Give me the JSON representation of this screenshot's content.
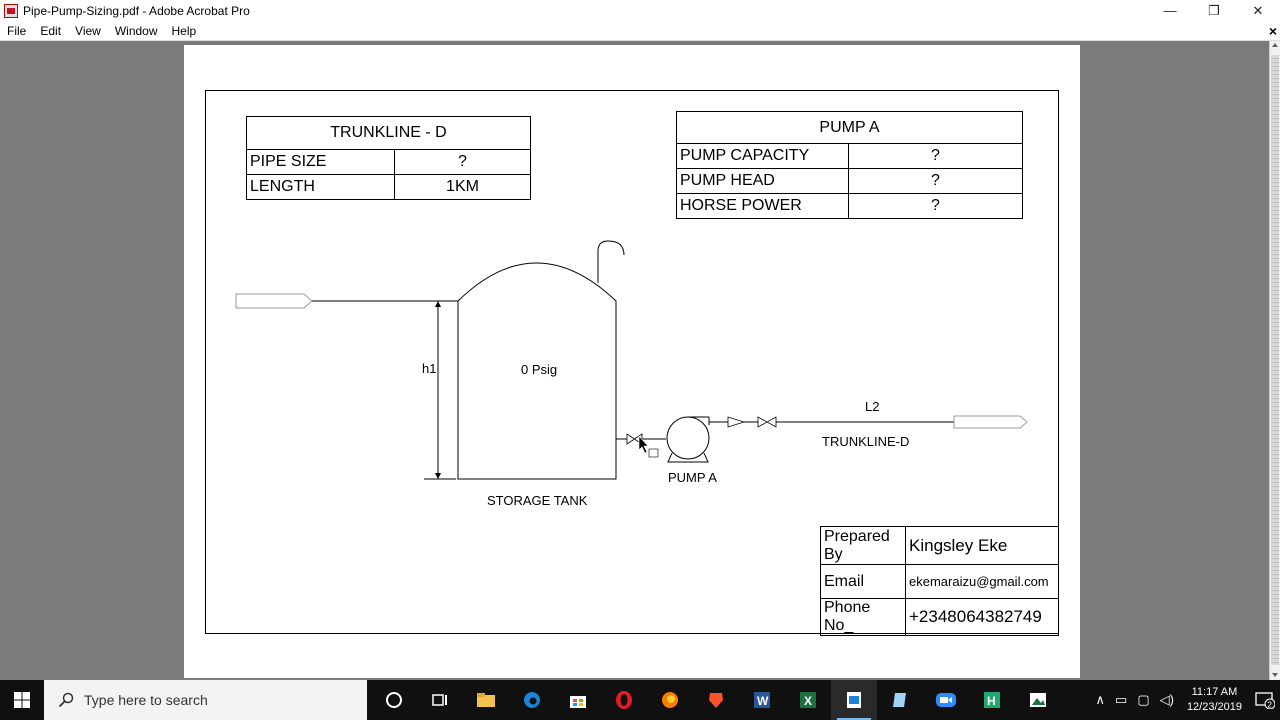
{
  "window": {
    "title": "Pipe-Pump-Sizing.pdf - Adobe Acrobat Pro",
    "minimize": "—",
    "restore": "❐",
    "close": "✕"
  },
  "menu": [
    {
      "label": "File"
    },
    {
      "label": "Edit"
    },
    {
      "label": "View"
    },
    {
      "label": "Window"
    },
    {
      "label": "Help"
    }
  ],
  "document_close": "×",
  "trunkline_table": {
    "title": "TRUNKLINE - D",
    "rows": [
      {
        "label": "PIPE SIZE",
        "value": "?"
      },
      {
        "label": "LENGTH",
        "value": "1KM"
      }
    ]
  },
  "pump_table": {
    "title": "PUMP A",
    "rows": [
      {
        "label": "PUMP CAPACITY",
        "value": "?"
      },
      {
        "label": "PUMP HEAD",
        "value": "?"
      },
      {
        "label": "HORSE POWER",
        "value": "?"
      }
    ]
  },
  "diagram": {
    "h1_label": "h1",
    "pressure_label": "0 Psig",
    "tank_label": "STORAGE TANK",
    "pump_label": "PUMP A",
    "l2_label": "L2",
    "trunkline_label": "TRUNKLINE-D"
  },
  "prepared": {
    "prepared_by_label": "Prepared By",
    "prepared_by_value": "Kingsley Eke",
    "email_label": "Email",
    "email_value": "ekemaraizu@gmail.com",
    "phone_label": "Phone No_",
    "phone_value": "+2348064382749"
  },
  "taskbar": {
    "search_placeholder": "Type here to search",
    "time": "11:17 AM",
    "date": "12/23/2019",
    "notification_count": "2",
    "icons": [
      "cortana-icon",
      "task-view-icon",
      "file-explorer-icon",
      "edge-icon",
      "store-icon",
      "opera-icon",
      "firefox-icon",
      "brave-icon",
      "word-icon",
      "excel-icon",
      "acrobat-icon",
      "notepad-icon",
      "zoom-icon",
      "hysys-icon",
      "photos-icon"
    ]
  },
  "colors": {
    "taskbar_bg": "#101010",
    "canvas_bg": "#7b7b7b",
    "excel_green": "#1d6f42",
    "word_blue": "#2b579a"
  }
}
